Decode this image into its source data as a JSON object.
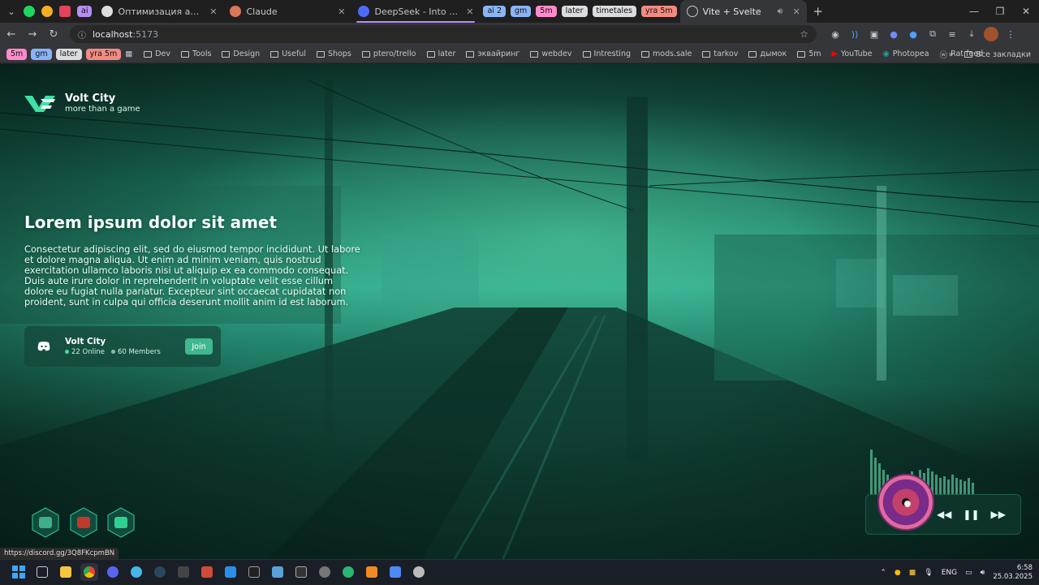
{
  "browser": {
    "tabs": [
      {
        "title": "",
        "favicon_color": "#1ed760",
        "kind": "pinned"
      },
      {
        "title": "",
        "favicon_color": "#f2b01e",
        "kind": "pinned"
      },
      {
        "title": "",
        "favicon_color": "#e2445c",
        "kind": "pinned"
      },
      {
        "title": "ai",
        "chip_color": "#b58df3",
        "kind": "chip"
      },
      {
        "title": "Оптимизация анимации баро",
        "favicon_color": "#dddddd",
        "kind": "normal"
      },
      {
        "title": "Claude",
        "favicon_color": "#d97757",
        "kind": "normal"
      },
      {
        "title": "DeepSeek - Into the Unknown",
        "favicon_color": "#4d6bfe",
        "kind": "normal"
      }
    ],
    "group_chips": [
      {
        "label": "ai 2",
        "color": "#8ab4f8"
      },
      {
        "label": "gm",
        "color": "#8ab4f8"
      },
      {
        "label": "5m",
        "color": "#ff8bcb"
      },
      {
        "label": "later",
        "color": "#dadce0"
      },
      {
        "label": "timetales",
        "color": "#dadce0"
      },
      {
        "label": "yra 5m",
        "color": "#f28b82"
      }
    ],
    "active_tab": {
      "title": "Vite + Svelte"
    },
    "address": {
      "host": "localhost",
      "port": ":5173"
    },
    "bookmark_chips": [
      {
        "label": "5m",
        "color": "#ff8bcb"
      },
      {
        "label": "gm",
        "color": "#8ab4f8"
      },
      {
        "label": "later",
        "color": "#dadce0"
      },
      {
        "label": "yra 5m",
        "color": "#f28b82"
      }
    ],
    "bookmarks": [
      "Dev",
      "Tools",
      "Design",
      "Useful",
      "Shops",
      "ptero/trello",
      "later",
      "эквайринг",
      "webdev",
      "Intresting",
      "mods.sale",
      "tarkov",
      "дымок",
      "5m",
      "YouTube",
      "Photopea",
      "Rat feed"
    ],
    "all_bookmarks": "Все закладки"
  },
  "page": {
    "brand": {
      "name": "Volt City",
      "tagline": "more than a game"
    },
    "hero": {
      "title": "Lorem ipsum dolor sit amet",
      "text": "Consectetur adipiscing elit, sed do eiusmod tempor incididunt. Ut labore et dolore magna aliqua. Ut enim ad minim veniam, quis nostrud exercitation ullamco laboris nisi ut aliquip ex ea commodo consequat. Duis aute irure dolor in reprehenderit in voluptate velit esse cillum dolore eu fugiat nulla pariatur. Excepteur sint occaecat cupidatat non proident, sunt in culpa qui officia deserunt mollit anim id est laborum."
    },
    "discord_card": {
      "server": "Volt City",
      "online": "22 Online",
      "members": "60 Members",
      "join_label": "Join"
    },
    "socials": [
      {
        "name": "discord",
        "color": "#3fae8c"
      },
      {
        "name": "youtube",
        "color": "#c0392b"
      },
      {
        "name": "site",
        "color": "#2fd08f"
      }
    ],
    "status_url": "https://discord.gg/3Q8FKcpmBN",
    "accent": "#3fb88f"
  },
  "taskbar": {
    "lang": "ENG",
    "time": "6:58",
    "date": "25.03.2025"
  }
}
